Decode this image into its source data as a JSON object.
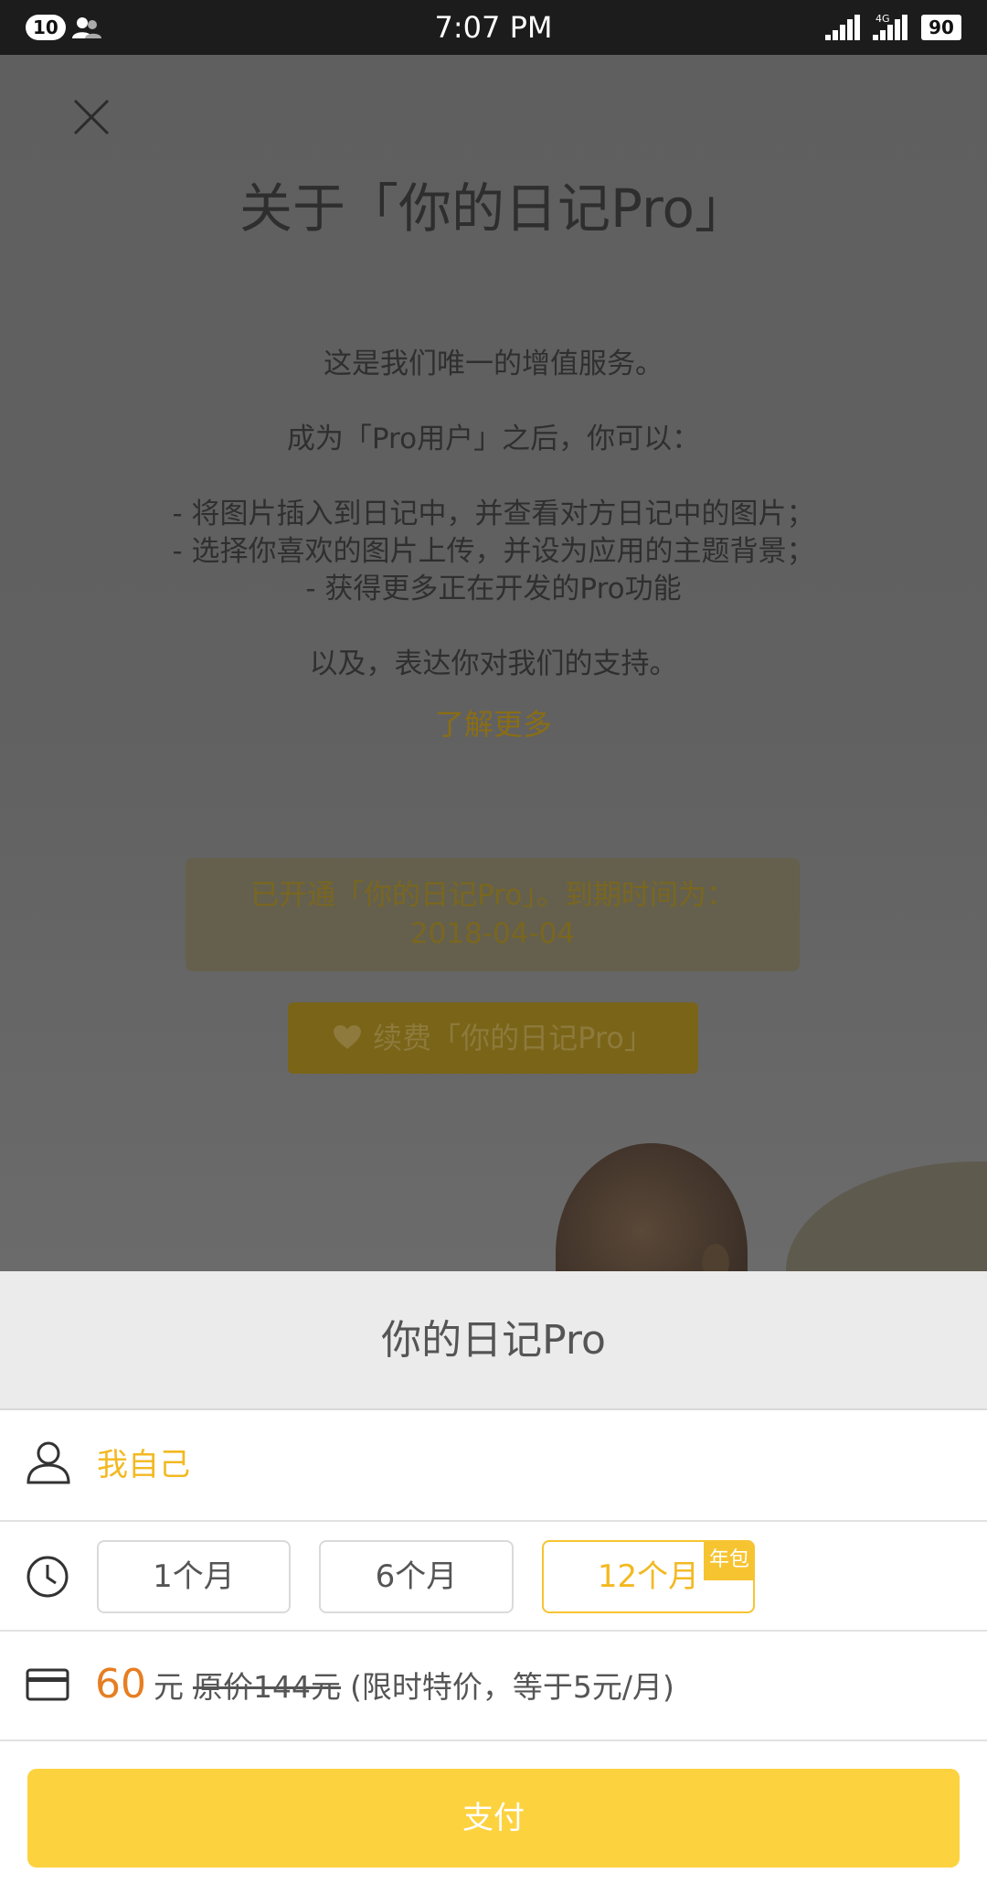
{
  "status_bar": {
    "notification_count": "10",
    "time": "7:07 PM",
    "network": "4G",
    "sim_slot": "2",
    "battery": "90",
    "icons": [
      "contacts-icon",
      "signal-icon",
      "signal-4g-icon"
    ]
  },
  "background_page": {
    "close_icon": "close-icon",
    "title": "关于「你的日记Pro」",
    "lines": [
      "这是我们唯一的增值服务。",
      "",
      "成为「Pro用户」之后，你可以：",
      "",
      "- 将图片插入到日记中，并查看对方日记中的图片；",
      "- 选择你喜欢的图片上传，并设为应用的主题背景；",
      "- 获得更多正在开发的Pro功能",
      "",
      "以及，表达你对我们的支持。"
    ],
    "learn_more": "了解更多",
    "status_line1": "已开通「你的日记Pro」。到期时间为：",
    "status_line2": "2018-04-04",
    "renew_label": "续费「你的日记Pro」"
  },
  "sheet": {
    "title": "你的日记Pro",
    "recipient": "我自己",
    "durations": [
      {
        "label": "1个月",
        "selected": false
      },
      {
        "label": "6个月",
        "selected": false
      },
      {
        "label": "12个月",
        "selected": true,
        "badge": "年包"
      }
    ],
    "price": {
      "amount": "60",
      "unit": "元",
      "original": "原价144元",
      "note": "(限时特价，等于5元/月)"
    },
    "pay_label": "支付"
  },
  "colors": {
    "accent": "#f7c431",
    "pay_button": "#fdd23f",
    "price": "#e67e22",
    "dim_overlay": "#606060"
  }
}
